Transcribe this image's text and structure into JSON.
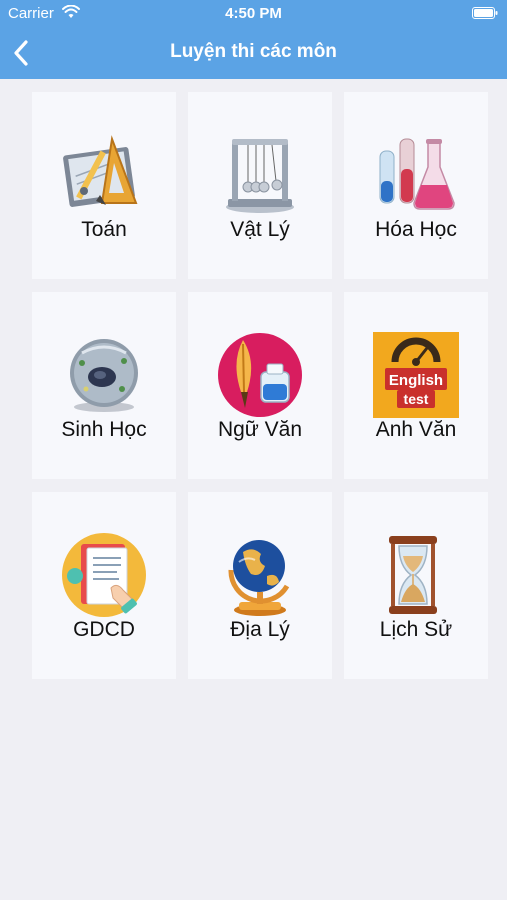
{
  "status_bar": {
    "carrier": "Carrier",
    "time": "4:50 PM"
  },
  "nav": {
    "title": "Luyện thi các môn",
    "back_icon": "chevron-left-icon"
  },
  "colors": {
    "header_bg": "#5ba3e5",
    "page_bg": "#efeff4",
    "card_bg": "#f7f8fc"
  },
  "subjects": [
    {
      "label": "Toán",
      "icon": "math-tools-icon"
    },
    {
      "label": "Vật Lý",
      "icon": "newtons-cradle-icon"
    },
    {
      "label": "Hóa Học",
      "icon": "chemistry-flask-icon"
    },
    {
      "label": "Sinh Học",
      "icon": "cell-icon"
    },
    {
      "label": "Ngữ Văn",
      "icon": "quill-ink-icon"
    },
    {
      "label": "Anh Văn",
      "icon": "english-test-icon",
      "icon_text": [
        "English",
        "test"
      ]
    },
    {
      "label": "GDCD",
      "icon": "civics-document-icon"
    },
    {
      "label": "Địa Lý",
      "icon": "globe-icon"
    },
    {
      "label": "Lịch Sử",
      "icon": "hourglass-icon"
    }
  ]
}
